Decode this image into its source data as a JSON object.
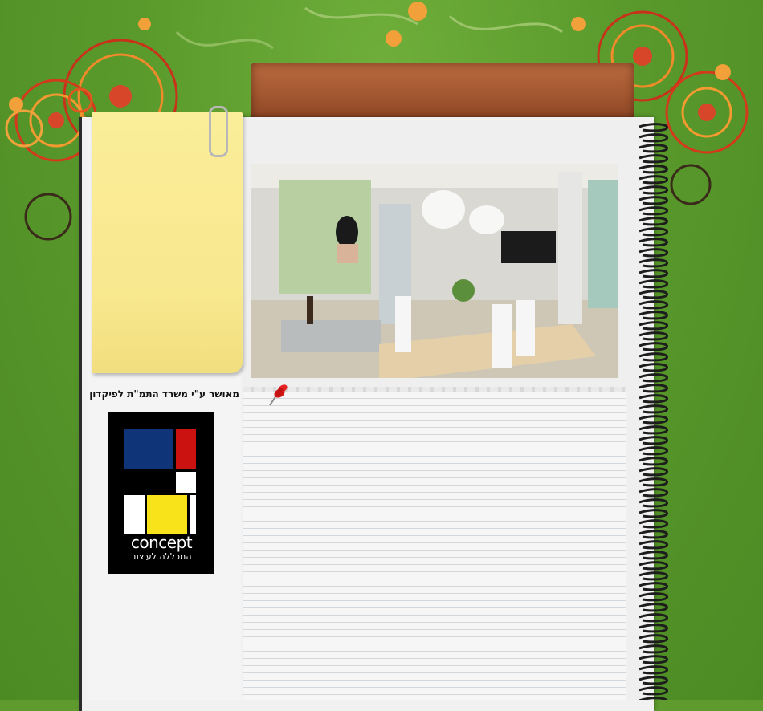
{
  "approval_text": "מאושר  ע\"י משרד התמ\"ת לפיקדון",
  "logo": {
    "word": "concept",
    "subtitle": "המכללה לעיצוב"
  },
  "colors": {
    "background": "#5e9a2e",
    "sticky_note": "#f8e88e",
    "tab": "#a65a32",
    "logo_blue": "#0f3478",
    "logo_red": "#cc1111",
    "logo_yellow": "#f8e21a"
  },
  "icons": {
    "pushpin": "pushpin-icon",
    "paperclip": "paperclip-icon"
  }
}
